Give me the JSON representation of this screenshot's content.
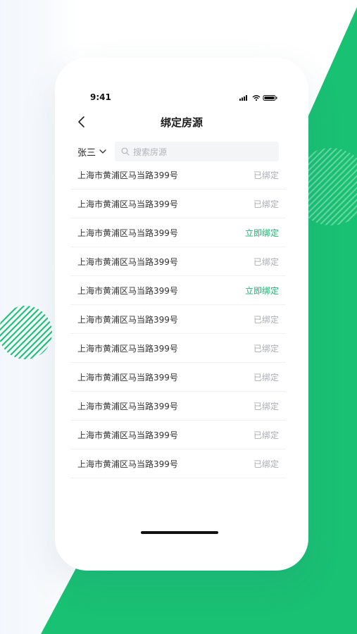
{
  "status_bar": {
    "time": "9:41"
  },
  "header": {
    "title": "绑定房源",
    "back_icon": "chevron-left-icon"
  },
  "filter": {
    "user": "张三",
    "dropdown_icon": "chevron-down-icon",
    "search_placeholder": "搜索房源",
    "search_icon": "search-icon"
  },
  "colors": {
    "accent": "#18b56d",
    "brand_green": "#19c173",
    "muted": "#a9acb2"
  },
  "list": [
    {
      "address": "上海市黄浦区马当路399号",
      "status": "已绑定",
      "bound": true
    },
    {
      "address": "上海市黄浦区马当路399号",
      "status": "已绑定",
      "bound": true
    },
    {
      "address": "上海市黄浦区马当路399号",
      "status": "立即绑定",
      "bound": false
    },
    {
      "address": "上海市黄浦区马当路399号",
      "status": "已绑定",
      "bound": true
    },
    {
      "address": "上海市黄浦区马当路399号",
      "status": "立即绑定",
      "bound": false
    },
    {
      "address": "上海市黄浦区马当路399号",
      "status": "已绑定",
      "bound": true
    },
    {
      "address": "上海市黄浦区马当路399号",
      "status": "已绑定",
      "bound": true
    },
    {
      "address": "上海市黄浦区马当路399号",
      "status": "已绑定",
      "bound": true
    },
    {
      "address": "上海市黄浦区马当路399号",
      "status": "已绑定",
      "bound": true
    },
    {
      "address": "上海市黄浦区马当路399号",
      "status": "已绑定",
      "bound": true
    },
    {
      "address": "上海市黄浦区马当路399号",
      "status": "已绑定",
      "bound": true
    }
  ]
}
